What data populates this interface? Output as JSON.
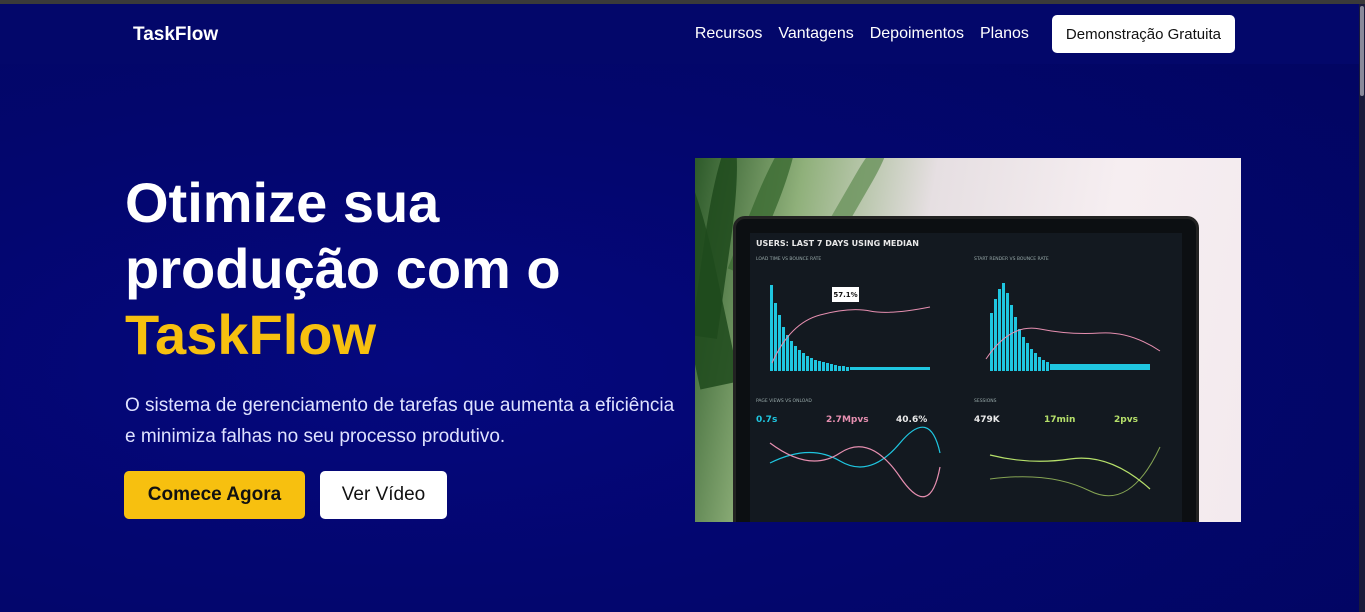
{
  "header": {
    "logo": "TaskFlow",
    "nav": [
      "Recursos",
      "Vantagens",
      "Depoimentos",
      "Planos"
    ],
    "cta": "Demonstração Gratuita"
  },
  "hero": {
    "title_line1": "Otimize sua",
    "title_line2": "produção com o",
    "title_accent": "TaskFlow",
    "subtitle": "O sistema de gerenciamento de tarefas que aumenta a eficiência e minimiza falhas no seu processo produtivo.",
    "primary_button": "Comece Agora",
    "secondary_button": "Ver Vídeo"
  },
  "dashboard_image": {
    "title": "USERS: LAST 7 DAYS USING MEDIAN",
    "panel1": "LOAD TIME VS BOUNCE RATE",
    "panel2": "START RENDER VS BOUNCE RATE",
    "panel3": "PAGE VIEWS VS ONLOAD",
    "panel4": "SESSIONS",
    "tooltip": "57.1%",
    "stat1": "0.7s",
    "stat2": "2.7Mpvs",
    "stat3": "40.6%",
    "stat4": "479K",
    "stat5": "17min",
    "stat6": "2pvs",
    "accent_cyan": "#1fc6e0",
    "accent_pink": "#e68fb0",
    "accent_green": "#b6e06a"
  },
  "colors": {
    "accent": "#f7c00f",
    "background": "#03076a"
  }
}
